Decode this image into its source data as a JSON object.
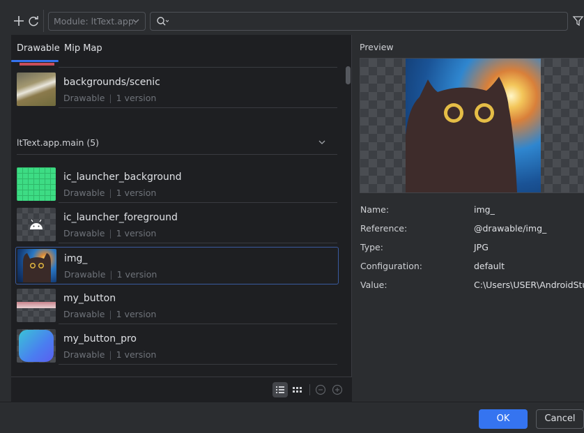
{
  "toolbar": {
    "module_label": "Module: ltText.app.",
    "search_value": ""
  },
  "tabs": [
    {
      "label": "Drawable",
      "active": true
    },
    {
      "label": "Mip Map",
      "active": false
    }
  ],
  "list": {
    "top_item": {
      "name": "backgrounds/scenic",
      "type": "Drawable",
      "versions": "1 version"
    },
    "group": {
      "title": "ltText.app.main (5)"
    },
    "items": [
      {
        "name": "ic_launcher_background",
        "type": "Drawable",
        "versions": "1 version"
      },
      {
        "name": "ic_launcher_foreground",
        "type": "Drawable",
        "versions": "1 version"
      },
      {
        "name": "img_",
        "type": "Drawable",
        "versions": "1 version",
        "selected": true
      },
      {
        "name": "my_button",
        "type": "Drawable",
        "versions": "1 version"
      },
      {
        "name": "my_button_pro",
        "type": "Drawable",
        "versions": "1 version"
      }
    ]
  },
  "preview": {
    "label": "Preview",
    "properties": [
      {
        "key": "Name:",
        "value": "img_"
      },
      {
        "key": "Reference:",
        "value": "@drawable/img_"
      },
      {
        "key": "Type:",
        "value": "JPG"
      },
      {
        "key": "Configuration:",
        "value": "default"
      },
      {
        "key": "Value:",
        "value": "C:\\Users\\USER\\AndroidStu..."
      }
    ]
  },
  "footer": {
    "ok_label": "OK",
    "cancel_label": "Cancel"
  },
  "colors": {
    "accent": "#3574f0",
    "background": "#2b2d30",
    "panel": "#1e1f22"
  }
}
